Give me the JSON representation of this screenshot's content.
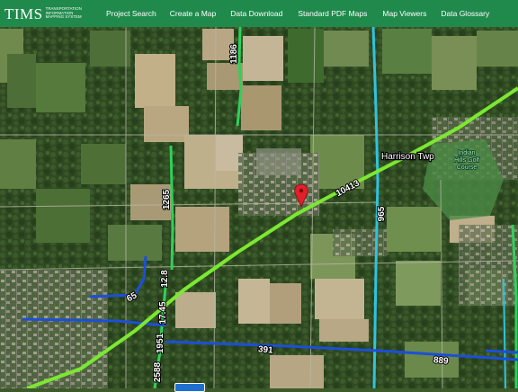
{
  "header": {
    "logo_text": "TIMS",
    "logo_sub": [
      "TRANSPORTATION",
      "INFORMATION",
      "MAPPING SYSTEM"
    ],
    "nav": [
      "Project Search",
      "Create a Map",
      "Data Download",
      "Standard PDF Maps",
      "Map Viewers",
      "Data Glossary"
    ]
  },
  "map": {
    "route_labels": {
      "r1186": "1186",
      "r1265": "1265",
      "r12_8": "12.8",
      "r65": "65",
      "r1745": "17.45",
      "r1951": "1951",
      "r2588": "2588",
      "r391": "391",
      "r889": "889",
      "r965": "965",
      "r10413": "10413"
    },
    "place_label": "Harrison Twp",
    "poi_label": [
      "Indian",
      "Hills Golf",
      "Course"
    ],
    "marker_icon": "map-pin-icon",
    "colors": {
      "highway": "#7be831",
      "green_route": "#2fd15a",
      "blue_route": "#1c4fd8",
      "cyan_route": "#2fc3e0",
      "header": "#1f8a4c"
    }
  }
}
